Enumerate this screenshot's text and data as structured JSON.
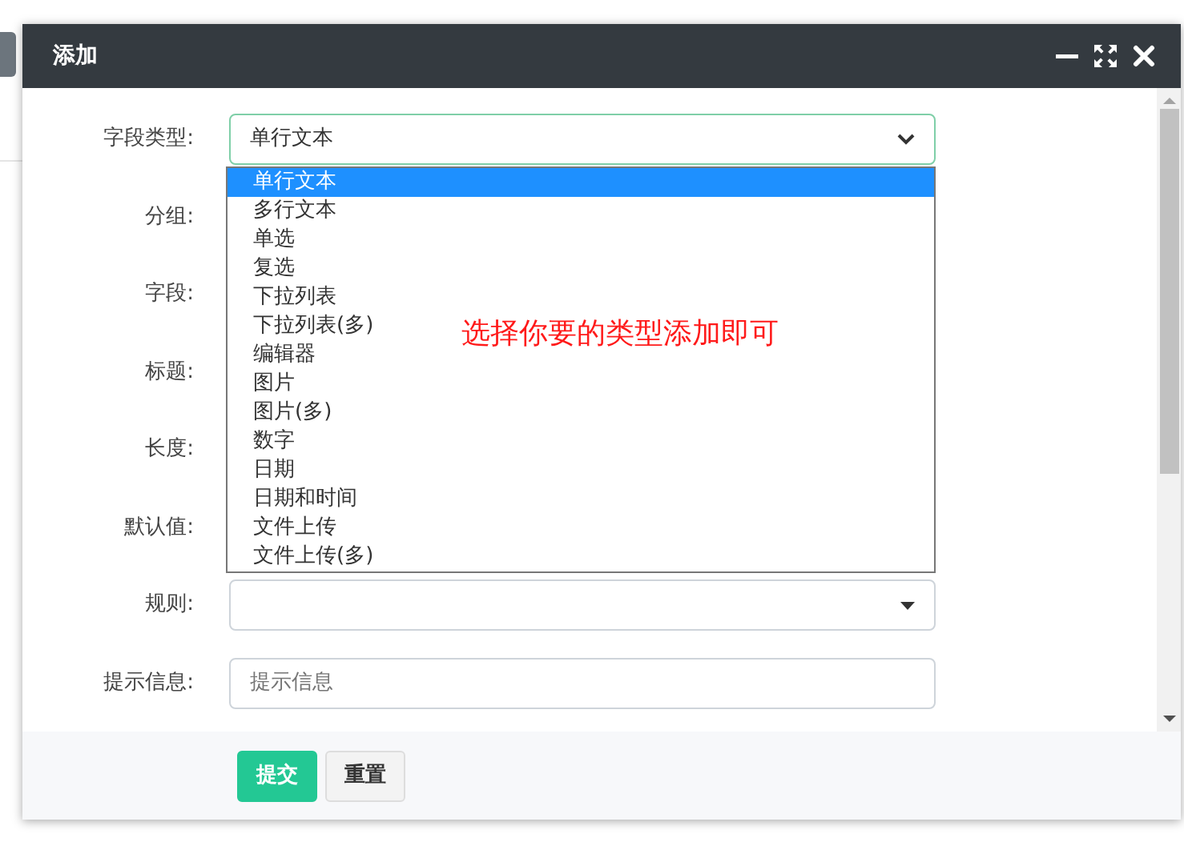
{
  "dialog": {
    "title": "添加"
  },
  "fields": [
    {
      "label": "字段类型:",
      "kind": "select",
      "value": "单行文本"
    },
    {
      "label": "分组:",
      "kind": "covered"
    },
    {
      "label": "字段:",
      "kind": "covered"
    },
    {
      "label": "标题:",
      "kind": "covered"
    },
    {
      "label": "长度:",
      "kind": "covered"
    },
    {
      "label": "默认值:",
      "kind": "covered"
    },
    {
      "label": "规则:",
      "kind": "combo"
    },
    {
      "label": "提示信息:",
      "kind": "text",
      "placeholder": "提示信息"
    }
  ],
  "options": [
    {
      "label": "单行文本",
      "selected": true
    },
    {
      "label": "多行文本",
      "selected": false
    },
    {
      "label": "单选",
      "selected": false
    },
    {
      "label": "复选",
      "selected": false
    },
    {
      "label": "下拉列表",
      "selected": false
    },
    {
      "label": "下拉列表(多)",
      "selected": false
    },
    {
      "label": "编辑器",
      "selected": false
    },
    {
      "label": "图片",
      "selected": false
    },
    {
      "label": "图片(多)",
      "selected": false
    },
    {
      "label": "数字",
      "selected": false
    },
    {
      "label": "日期",
      "selected": false
    },
    {
      "label": "日期和时间",
      "selected": false
    },
    {
      "label": "文件上传",
      "selected": false
    },
    {
      "label": "文件上传(多)",
      "selected": false
    }
  ],
  "annotation": "选择你要的类型添加即可",
  "buttons": [
    {
      "label": "提交",
      "kind": "primary"
    },
    {
      "label": "重置",
      "kind": "secondary"
    }
  ]
}
